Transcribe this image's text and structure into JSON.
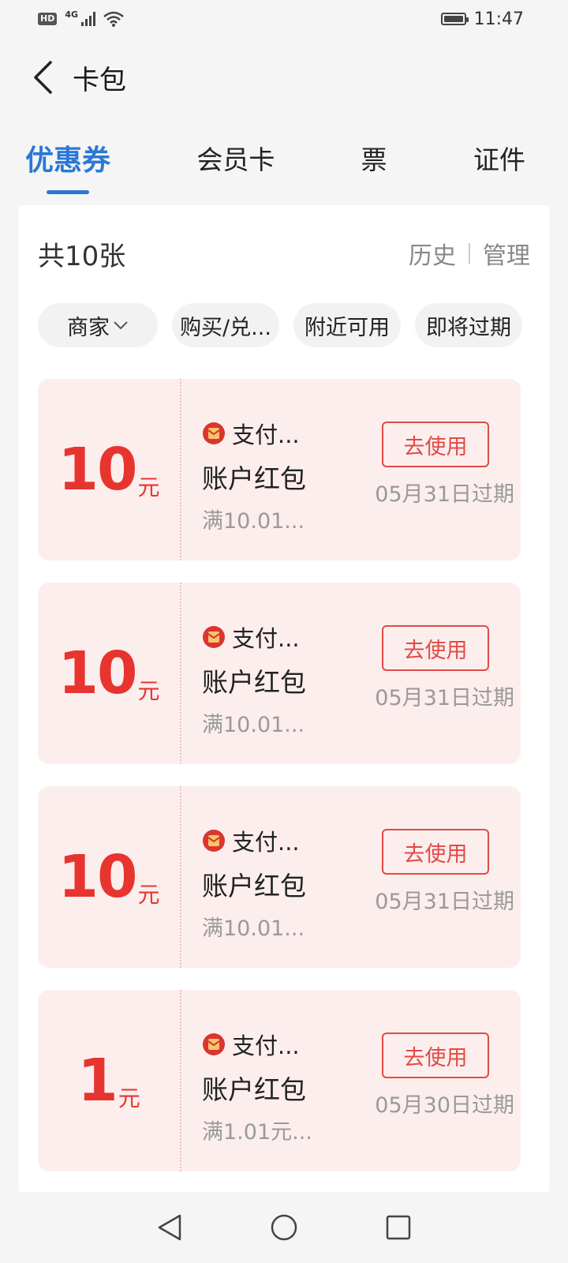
{
  "status_bar": {
    "hd": "HD",
    "network": "4G",
    "time": "11:47"
  },
  "header": {
    "title": "卡包"
  },
  "tabs": [
    {
      "label": "优惠券"
    },
    {
      "label": "会员卡"
    },
    {
      "label": "票"
    },
    {
      "label": "证件"
    }
  ],
  "summary": {
    "count_text": "共10张",
    "history": "历史",
    "manage": "管理"
  },
  "filters": [
    {
      "label": "商家"
    },
    {
      "label": "购买/兑..."
    },
    {
      "label": "附近可用"
    },
    {
      "label": "即将过期"
    }
  ],
  "coupons": [
    {
      "amount": "10",
      "unit": "元",
      "merchant": "支付...",
      "title": "账户红包",
      "condition": "满10.01...",
      "button": "去使用",
      "expire": "05月31日过期"
    },
    {
      "amount": "10",
      "unit": "元",
      "merchant": "支付...",
      "title": "账户红包",
      "condition": "满10.01...",
      "button": "去使用",
      "expire": "05月31日过期"
    },
    {
      "amount": "10",
      "unit": "元",
      "merchant": "支付...",
      "title": "账户红包",
      "condition": "满10.01...",
      "button": "去使用",
      "expire": "05月31日过期"
    },
    {
      "amount": "1",
      "unit": "元",
      "merchant": "支付...",
      "title": "账户红包",
      "condition": "满1.01元...",
      "button": "去使用",
      "expire": "05月30日过期"
    }
  ],
  "colors": {
    "accent": "#2a78d6",
    "coupon_red": "#e8342f",
    "coupon_bg": "#fdeeee"
  },
  "icons": {
    "back": "chevron-left-icon",
    "merchant": "red-envelope-icon",
    "nav_back": "triangle-back-icon",
    "nav_home": "circle-home-icon",
    "nav_recent": "square-recent-icon"
  }
}
